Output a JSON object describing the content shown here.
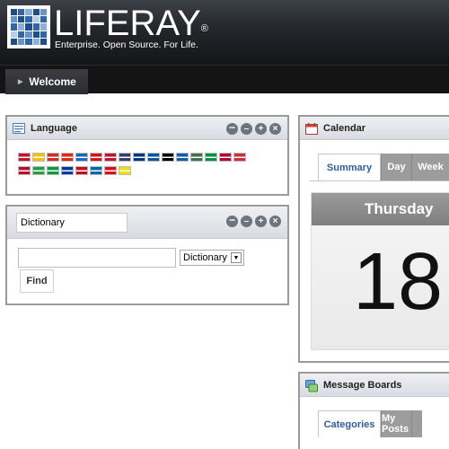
{
  "brand": {
    "name": "LIFERAY",
    "trademark": "®",
    "tagline": "Enterprise. Open Source. For Life."
  },
  "nav": {
    "tabs": [
      {
        "label": "Welcome"
      }
    ]
  },
  "language": {
    "title": "Language",
    "flag_row1": [
      "#c8102e",
      "#f4c300",
      "#d52b1e",
      "#de2910",
      "#1e64c8",
      "#d7141a",
      "#c8102e",
      "#3c3b6e",
      "#003580",
      "#0055a4",
      "#000000",
      "#0d5eaf",
      "#436f4d",
      "#009246",
      "#bc002d",
      "#cd2e3a"
    ],
    "flag_row2": [
      "#ba0c2f",
      "#239f40",
      "#009c3b",
      "#0039a6",
      "#c60b1e",
      "#006aa7",
      "#e30a17",
      "#f3dd00"
    ]
  },
  "dictionary": {
    "title_value": "Dictionary",
    "search_value": "",
    "select_value": "Dictionary",
    "find_label": "Find"
  },
  "calendar": {
    "title": "Calendar",
    "tabs": [
      "Summary",
      "Day",
      "Week"
    ],
    "day_name": "Thursday",
    "day_number": "18"
  },
  "message_boards": {
    "title": "Message Boards",
    "tabs": [
      "Categories",
      "My Posts"
    ]
  },
  "controls": {
    "menu": "•••",
    "minimize": "–",
    "maximize": "+",
    "close": "×"
  }
}
